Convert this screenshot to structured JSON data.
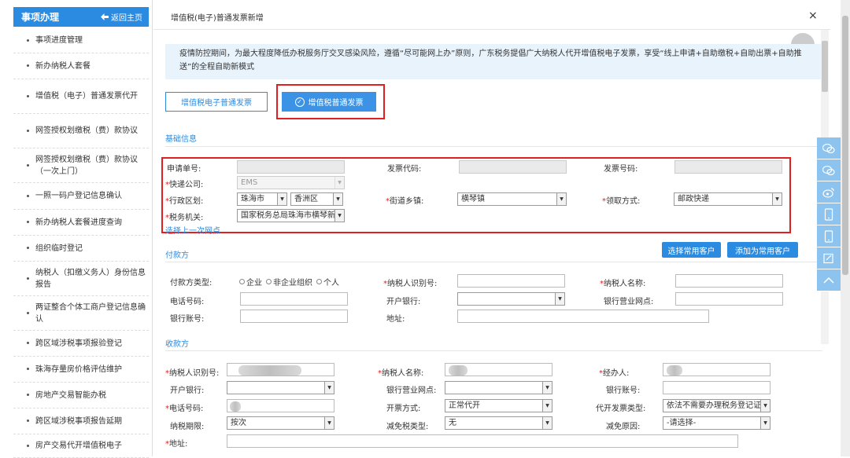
{
  "sidebar": {
    "title": "事项办理",
    "back_label": "返回主页",
    "items": [
      {
        "label": "事项进度管理"
      },
      {
        "label": "新办纳税人套餐"
      },
      {
        "label": "增值税（电子）普通发票代开"
      },
      {
        "label": "网签授权划缴税（费）款协议"
      },
      {
        "label": "网签授权划缴税（费）款协议（一次上门）"
      },
      {
        "label": "一照一码户登记信息确认"
      },
      {
        "label": "新办纳税人套餐进度查询"
      },
      {
        "label": "组织临时登记"
      },
      {
        "label": "纳税人（扣缴义务人）身份信息报告"
      },
      {
        "label": "两证整合个体工商户登记信息确认"
      },
      {
        "label": "跨区域涉税事项报验登记"
      },
      {
        "label": "珠海存量房价格评估维护"
      },
      {
        "label": "房地产交易智能办税"
      },
      {
        "label": "跨区域涉税事项报告延期"
      },
      {
        "label": "房产交易代开增值税电子"
      }
    ]
  },
  "dialog": {
    "title": "增值税(电子)普通发票新增",
    "close": "×"
  },
  "notice": "疫情防控期间，为最大程度降低办税服务厅交叉感染风险，遵循“尽可能网上办”原则，广东税务提倡广大纳税人代开增值税电子发票，享受“线上申请+自助缴税+自助出票+自助推送”的全程自助新模式",
  "tabs": {
    "electronic": "增值税电子普通发票",
    "paper": "增值税普通发票"
  },
  "basic": {
    "section": "基础信息",
    "apply_no": "申请单号:",
    "invoice_code": "发票代码:",
    "invoice_no": "发票号码:",
    "express_company": "快递公司:",
    "express_value": "EMS",
    "admin_region": "行政区划:",
    "city": "珠海市",
    "district": "香洲区",
    "street": "街道乡镇:",
    "street_value": "横琴镇",
    "pickup": "领取方式:",
    "pickup_value": "邮政快递",
    "tax_office": "税务机关:",
    "tax_office_value": "国家税务总局珠海市横琴新区",
    "select_last": "选择上一次网点"
  },
  "payer": {
    "section": "付款方",
    "btn_select": "选择常用客户",
    "btn_add": "添加为常用客户",
    "type_label": "付款方类型:",
    "type_options": [
      "企业",
      "非企业组织",
      "个人"
    ],
    "taxpayer_id": "纳税人识别号:",
    "taxpayer_name": "纳税人名称:",
    "phone": "电话号码:",
    "bank": "开户银行:",
    "bank_branch": "银行营业网点:",
    "account": "银行账号:",
    "address": "地址:"
  },
  "payee": {
    "section": "收款方",
    "taxpayer_id": "纳税人识别号:",
    "taxpayer_name": "纳税人名称:",
    "agent": "经办人:",
    "bank": "开户银行:",
    "bank_branch": "银行营业网点:",
    "account": "银行账号:",
    "phone": "电话号码:",
    "issue_method": "开票方式:",
    "issue_method_value": "正常代开",
    "invoice_type": "代开发票类型:",
    "invoice_type_value": "依法不需要办理税务登记证的",
    "tax_period": "纳税期限:",
    "tax_period_value": "按次",
    "exempt_type": "减免税类型:",
    "exempt_type_value": "无",
    "exempt_reason": "减免原因:",
    "exempt_reason_value": "-请选择-",
    "address": "地址:"
  },
  "colors": {
    "primary": "#2b8be0",
    "highlight": "#e02020",
    "notice_bg": "#e8f3fc"
  }
}
